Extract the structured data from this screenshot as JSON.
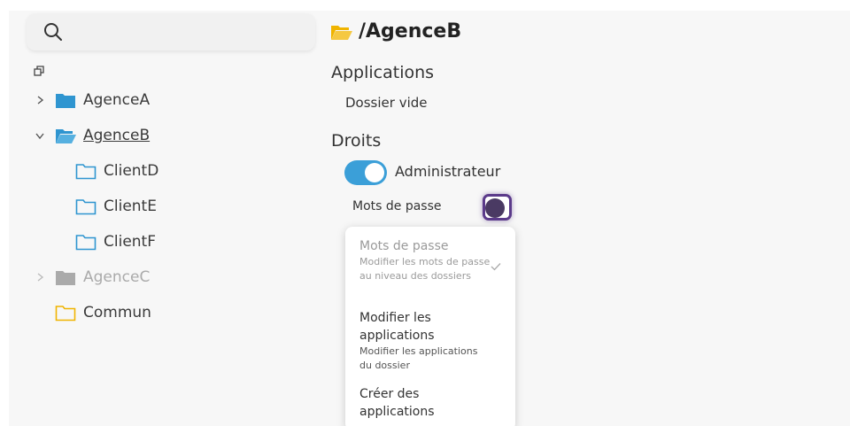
{
  "search": {
    "placeholder": ""
  },
  "tree": [
    {
      "label": "AgenceA",
      "expanded": false,
      "state": "normal",
      "color": "#2f95d0"
    },
    {
      "label": "AgenceB",
      "expanded": true,
      "state": "selected",
      "color": "#2f95d0"
    },
    {
      "label": "ClientD",
      "state": "normal",
      "color": "#2f95d0"
    },
    {
      "label": "ClientE",
      "state": "normal",
      "color": "#2f95d0"
    },
    {
      "label": "ClientF",
      "state": "normal",
      "color": "#2f95d0"
    },
    {
      "label": "AgenceC",
      "expanded": false,
      "state": "disabled",
      "color": "#aaaaaa"
    },
    {
      "label": "Commun",
      "state": "normal",
      "color": "#f0b400"
    }
  ],
  "main": {
    "path": "/AgenceB",
    "applications": {
      "heading": "Applications",
      "empty": "Dossier vide"
    },
    "rights": {
      "heading": "Droits",
      "toggle_label": "Administrateur",
      "toggle_on": true,
      "select_value": "Mots de passe",
      "dropdown": [
        {
          "title": "Mots de passe",
          "desc": "Modifier les mots de passe au niveau des dossiers",
          "selected": true
        },
        {
          "title": "Modifier les applications",
          "desc": "Modifier les applications du dossier",
          "selected": false
        },
        {
          "title": "Créer des applications",
          "desc": "",
          "selected": false
        }
      ]
    }
  },
  "colors": {
    "accent": "#3b9fd8",
    "focus": "#5b3a8a",
    "folder_yellow": "#f0b400"
  }
}
